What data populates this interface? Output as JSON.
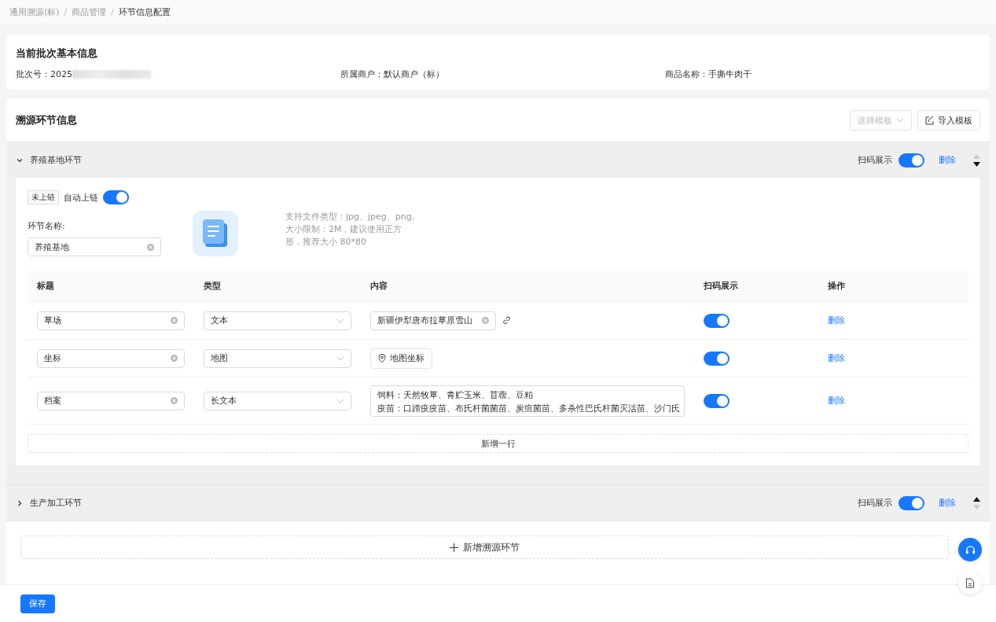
{
  "breadcrumb_separator": "/",
  "breadcrumb": [
    {
      "label": "通用溯源(标)",
      "selected": false
    },
    {
      "label": "商品管理",
      "selected": false
    },
    {
      "label": "环节信息配置",
      "selected": true
    }
  ],
  "basic_info": {
    "title": "当前批次基本信息",
    "fields": [
      {
        "label": "批次号：",
        "value": "2025",
        "redacted": true
      },
      {
        "label": "所属商户：",
        "value": "默认商户（标）",
        "redacted": false
      },
      {
        "label": "商品名称：",
        "value": "手撕牛肉干",
        "redacted": false
      }
    ]
  },
  "trace_section": {
    "title": "溯源环节信息",
    "select_template": {
      "label": "选择模板",
      "disabled": true
    },
    "import_template": {
      "label": "导入模板"
    }
  },
  "stages": [
    {
      "name": "养殖基地环节",
      "expanded": true,
      "scan_label": "扫码展示",
      "scan_on": true,
      "delete": "删除",
      "up_enabled": false,
      "down_enabled": true,
      "chain_status": "未上链",
      "auto_chain": {
        "label": "自动上链",
        "on": true
      },
      "name_label": "环节名称:",
      "name_value": "养殖基地",
      "upload_hint": [
        "支持文件类型：jpg、jpeg、png,",
        "大小限制：2M，建议使用正方",
        "形，推荐大小 80*80"
      ],
      "columns": [
        "标题",
        "类型",
        "内容",
        "扫码展示",
        "操作"
      ],
      "rows": [
        {
          "title": "草场",
          "type": "文本",
          "kind": "text",
          "content": "新疆伊犁唐布拉草原雪山",
          "scan_on": true,
          "action": "删除"
        },
        {
          "title": "坐标",
          "type": "地图",
          "kind": "map",
          "content": "地图坐标",
          "scan_on": true,
          "action": "删除"
        },
        {
          "title": "档案",
          "type": "长文本",
          "kind": "longtext",
          "content_lines": [
            "饲料：天然牧草、青贮玉米、苜蓿、豆粕",
            "疫苗：口蹄疫疫苗、布氏杆菌菌苗、炭疽菌苗、多杀性巴氏杆菌灭活苗、沙门氏"
          ],
          "scan_on": true,
          "action": "删除"
        }
      ],
      "add_row": "新增一行"
    },
    {
      "name": "生产加工环节",
      "expanded": false,
      "scan_label": "扫码展示",
      "scan_on": true,
      "delete": "删除",
      "up_enabled": true,
      "down_enabled": false
    }
  ],
  "add_stage": "新增溯源环节",
  "save": "保存"
}
